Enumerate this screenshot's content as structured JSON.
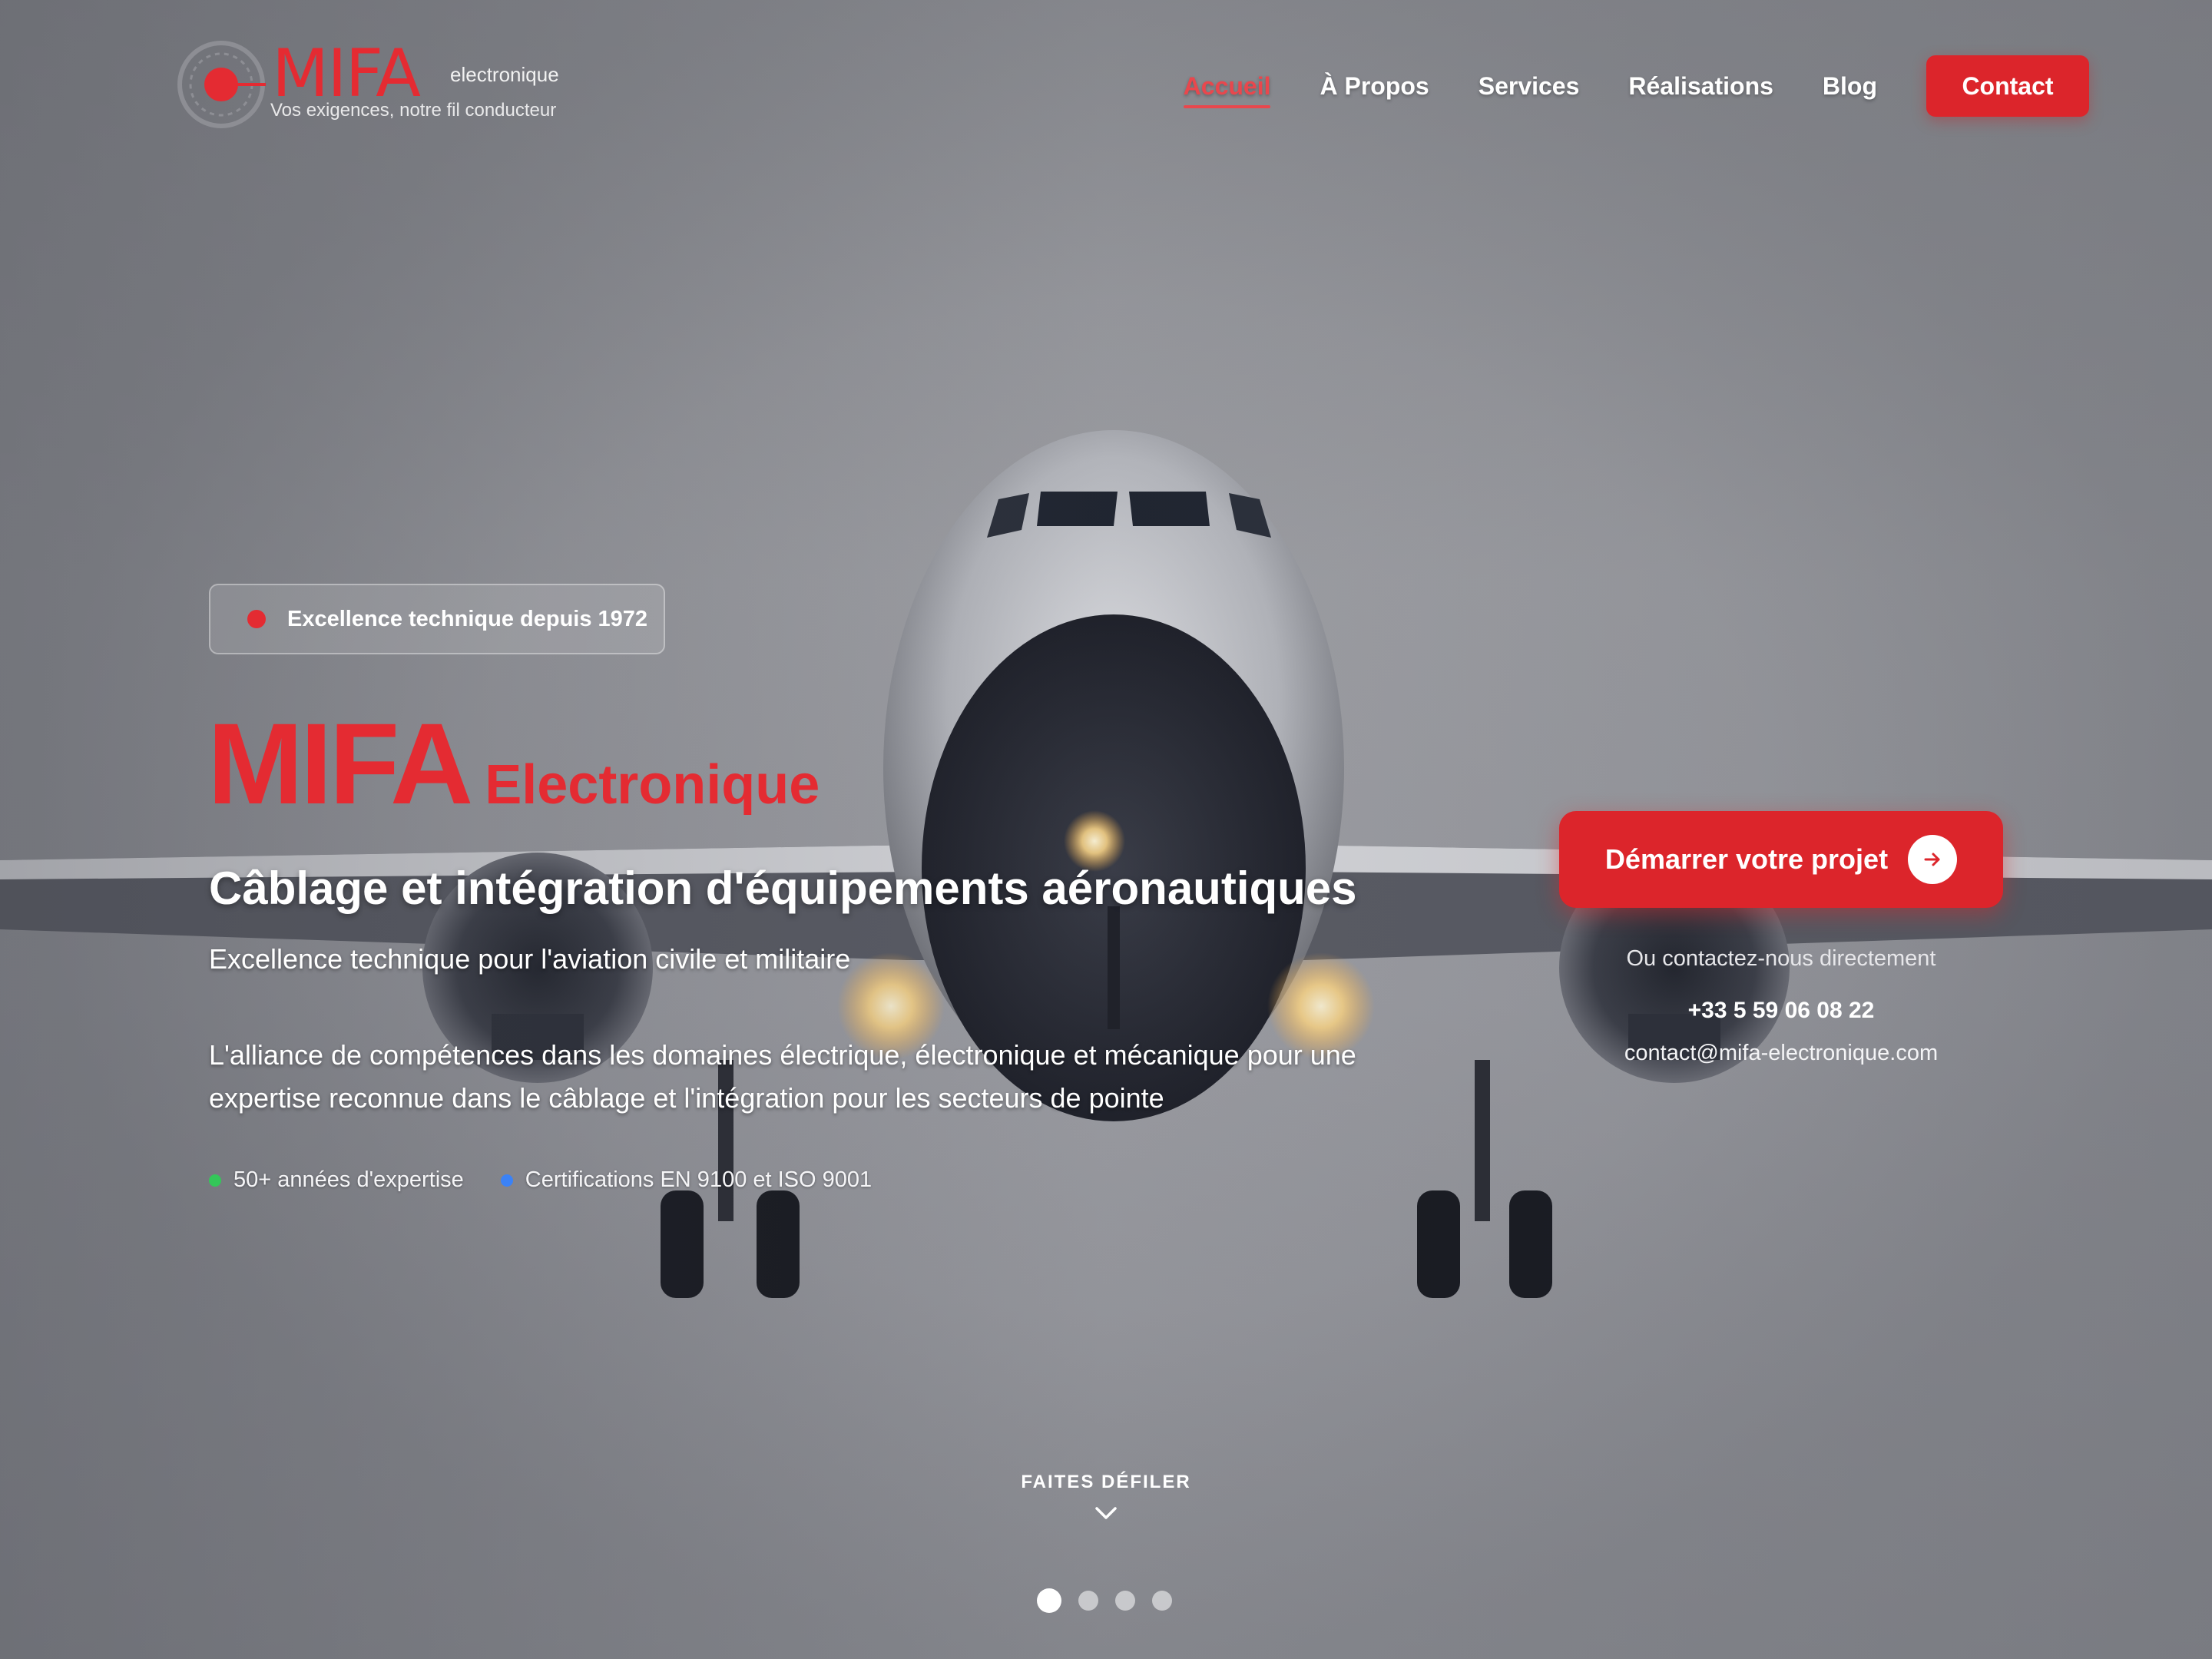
{
  "brand": {
    "logo_word": "MIFA",
    "logo_sub": "electronique",
    "tagline": "Vos exigences, notre fil conducteur",
    "accent_color": "#dc252b"
  },
  "nav": {
    "items": [
      {
        "label": "Accueil",
        "active": true
      },
      {
        "label": "À Propos"
      },
      {
        "label": "Services"
      },
      {
        "label": "Réalisations"
      },
      {
        "label": "Blog"
      }
    ],
    "cta_label": "Contact"
  },
  "hero": {
    "badge": "Excellence technique depuis 1972",
    "title_main": "MIFA",
    "title_sub": "Electronique",
    "heading": "Câblage et intégration d'équipements aéronautiques",
    "subheading": "Excellence technique pour l'aviation civile et militaire",
    "description": "L'alliance de compétences dans les domaines électrique, électronique et mécanique pour une expertise reconnue dans le câblage et l'intégration pour les secteurs de pointe",
    "features": [
      {
        "label": "50+ années d'expertise",
        "color": "#34c759"
      },
      {
        "label": "Certifications EN 9100 et ISO 9001",
        "color": "#3b82f6"
      }
    ]
  },
  "cta": {
    "primary_label": "Démarrer votre projet",
    "contact_label": "Ou contactez-nous directement",
    "phone": "+33 5 59 06 08 22",
    "email": "contact@mifa-electronique.com"
  },
  "scroll": {
    "label": "FAITES DÉFILER",
    "slides": 4,
    "active_slide": 1
  }
}
